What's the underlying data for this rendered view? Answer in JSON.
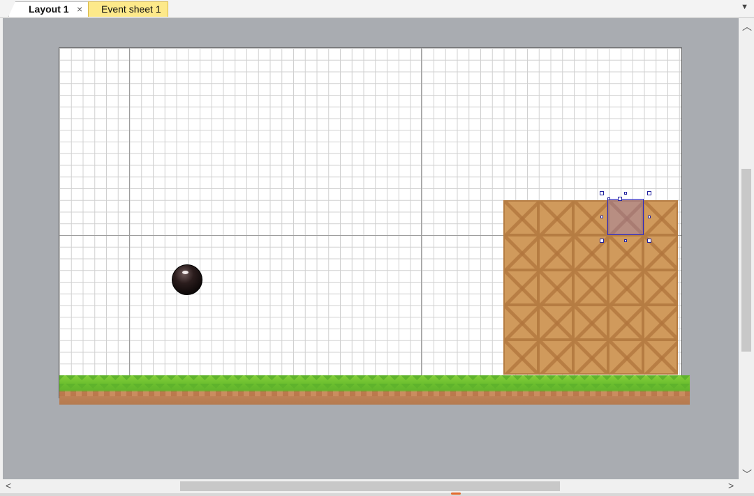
{
  "tabs": [
    {
      "label": "Layout 1",
      "active": true,
      "close_icon": "×"
    },
    {
      "label": "Event sheet 1",
      "active": false
    }
  ],
  "tab_dropdown_icon": "▼",
  "scrollbars": {
    "up": "︿",
    "down": "﹀",
    "left": "<",
    "right": ">"
  },
  "colors": {
    "workspace": "#a9acb1",
    "grass": "#6cbf2f",
    "crate": "#d09a5c",
    "selection_border": "#2a2ac8"
  },
  "layout": {
    "objects": [
      "ball-sprite",
      "crate-tilemap",
      "ground-tiles"
    ],
    "crate_grid": {
      "columns": 5,
      "rows": 5
    },
    "selected_object": "crate-tile"
  }
}
